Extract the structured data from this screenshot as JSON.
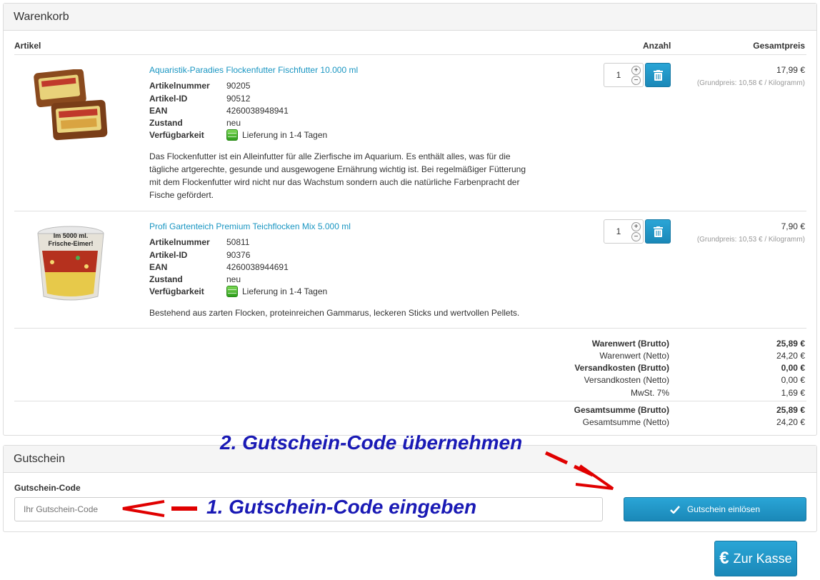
{
  "cart": {
    "title": "Warenkorb",
    "headers": {
      "article": "Artikel",
      "quantity": "Anzahl",
      "total": "Gesamtpreis"
    },
    "items": [
      {
        "name": "Aquaristik-Paradies Flockenfutter Fischfutter 10.000 ml",
        "attrs": [
          {
            "label": "Artikelnummer",
            "value": "90205"
          },
          {
            "label": "Artikel-ID",
            "value": "90512"
          },
          {
            "label": "EAN",
            "value": "4260038948941"
          },
          {
            "label": "Zustand",
            "value": "neu"
          }
        ],
        "availability_label": "Verfügbarkeit",
        "availability": "Lieferung in 1-4 Tagen",
        "description": "Das Flockenfutter ist ein Alleinfutter für alle Zierfische im Aquarium. Es enthält alles, was für die tägliche artgerechte, gesunde und ausgewogene Ernährung wichtig ist. Bei regelmäßiger Fütterung mit dem Flockenfutter wird nicht nur das Wachstum sondern auch die natürliche Farbenpracht der Fische gefördert.",
        "quantity": "1",
        "price": "17,99 €",
        "base_price": "(Grundpreis: 10,58 € / Kilogramm)"
      },
      {
        "name": "Profi Gartenteich Premium Teichflocken Mix 5.000 ml",
        "image_text": "Im 5000 ml. Frische-Eimer!",
        "attrs": [
          {
            "label": "Artikelnummer",
            "value": "50811"
          },
          {
            "label": "Artikel-ID",
            "value": "90376"
          },
          {
            "label": "EAN",
            "value": "4260038944691"
          },
          {
            "label": "Zustand",
            "value": "neu"
          }
        ],
        "availability_label": "Verfügbarkeit",
        "availability": "Lieferung in 1-4 Tagen",
        "description": "Bestehend aus zarten Flocken, proteinreichen Gammarus, leckeren Sticks und wertvollen Pellets.",
        "quantity": "1",
        "price": "7,90 €",
        "base_price": "(Grundpreis: 10,53 € / Kilogramm)"
      }
    ],
    "summary": [
      {
        "label": "Warenwert (Brutto)",
        "value": "25,89 €"
      },
      {
        "label": "Warenwert (Netto)",
        "value": "24,20 €"
      },
      {
        "label": "Versandkosten (Brutto)",
        "value": "0,00 €"
      },
      {
        "label": "Versandkosten (Netto)",
        "value": "0,00 €"
      },
      {
        "label": "MwSt. 7%",
        "value": "1,69 €"
      }
    ],
    "totals": [
      {
        "label": "Gesamtsumme (Brutto)",
        "value": "25,89 €"
      },
      {
        "label": "Gesamtsumme (Netto)",
        "value": "24,20 €"
      }
    ]
  },
  "voucher": {
    "title": "Gutschein",
    "field_label": "Gutschein-Code",
    "placeholder": "Ihr Gutschein-Code",
    "button": "Gutschein einlösen"
  },
  "checkout": {
    "label": "Zur Kasse",
    "icon": "€"
  },
  "annotations": {
    "step1": "1. Gutschein-Code eingeben",
    "step2": "2. Gutschein-Code übernehmen",
    "color": "#1a1ab5",
    "arrow_color": "#e00000"
  },
  "colors": {
    "accent": "#1a96c2",
    "link": "#1a96c2",
    "available": "#3fb22a"
  },
  "icons": [
    "trash-icon",
    "plus-icon",
    "minus-icon",
    "check-icon",
    "euro-icon",
    "availability-icon"
  ]
}
